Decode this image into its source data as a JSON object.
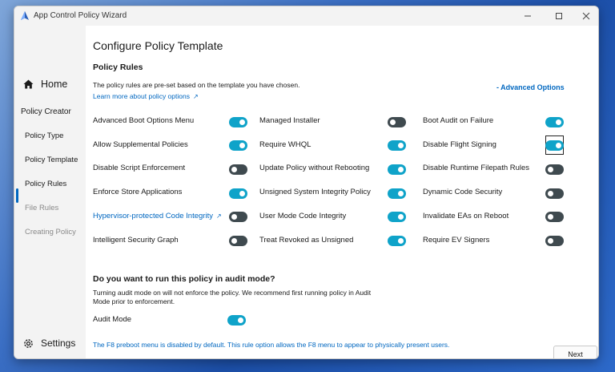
{
  "window": {
    "title": "App Control Policy Wizard"
  },
  "sidebar": {
    "home": "Home",
    "section": "Policy Creator",
    "items": [
      {
        "label": "Policy Type",
        "state": "enabled"
      },
      {
        "label": "Policy Template",
        "state": "enabled"
      },
      {
        "label": "Policy Rules",
        "state": "selected"
      },
      {
        "label": "File Rules",
        "state": "disabled"
      },
      {
        "label": "Creating Policy",
        "state": "disabled"
      }
    ],
    "settings": "Settings"
  },
  "main": {
    "page_title": "Configure Policy Template",
    "rules_heading": "Policy Rules",
    "rules_desc": "The policy rules are pre-set based on the template you have chosen.",
    "learn_more": "Learn more about policy options",
    "advanced_options": "- Advanced Options",
    "rules": [
      {
        "label": "Advanced Boot Options Menu",
        "on": true
      },
      {
        "label": "Managed Installer",
        "on": false
      },
      {
        "label": "Boot Audit on Failure",
        "on": true
      },
      {
        "label": "Allow Supplemental Policies",
        "on": true
      },
      {
        "label": "Require WHQL",
        "on": true
      },
      {
        "label": "Disable Flight Signing",
        "on": true,
        "focused": true
      },
      {
        "label": "Disable Script Enforcement",
        "on": false
      },
      {
        "label": "Update Policy without Rebooting",
        "on": true
      },
      {
        "label": "Disable Runtime Filepath Rules",
        "on": false
      },
      {
        "label": "Enforce Store Applications",
        "on": true
      },
      {
        "label": "Unsigned System Integrity Policy",
        "on": true
      },
      {
        "label": "Dynamic Code Security",
        "on": false
      },
      {
        "label": "Hypervisor-protected Code Integrity",
        "on": false,
        "link": true
      },
      {
        "label": "User Mode Code Integrity",
        "on": true
      },
      {
        "label": "Invalidate EAs on Reboot",
        "on": false
      },
      {
        "label": "Intelligent Security Graph",
        "on": false
      },
      {
        "label": "Treat Revoked as Unsigned",
        "on": true
      },
      {
        "label": "Require EV Signers",
        "on": false
      }
    ],
    "audit_heading": "Do you want to run this policy in audit mode?",
    "audit_desc_1": "Turning audit mode on will not enforce the policy. We recommend first running policy in Audit",
    "audit_desc_2": "Mode prior to enforcement.",
    "audit_mode_label": "Audit Mode",
    "audit_mode_on": true,
    "footer_note": "The F8 preboot menu is disabled by default. This rule option allows the F8 menu to appear to physically present users.",
    "next_label": "Next"
  },
  "colors": {
    "accent": "#0067c0",
    "toggle_on": "#0fa3c9",
    "toggle_off": "#3f4a4f"
  }
}
